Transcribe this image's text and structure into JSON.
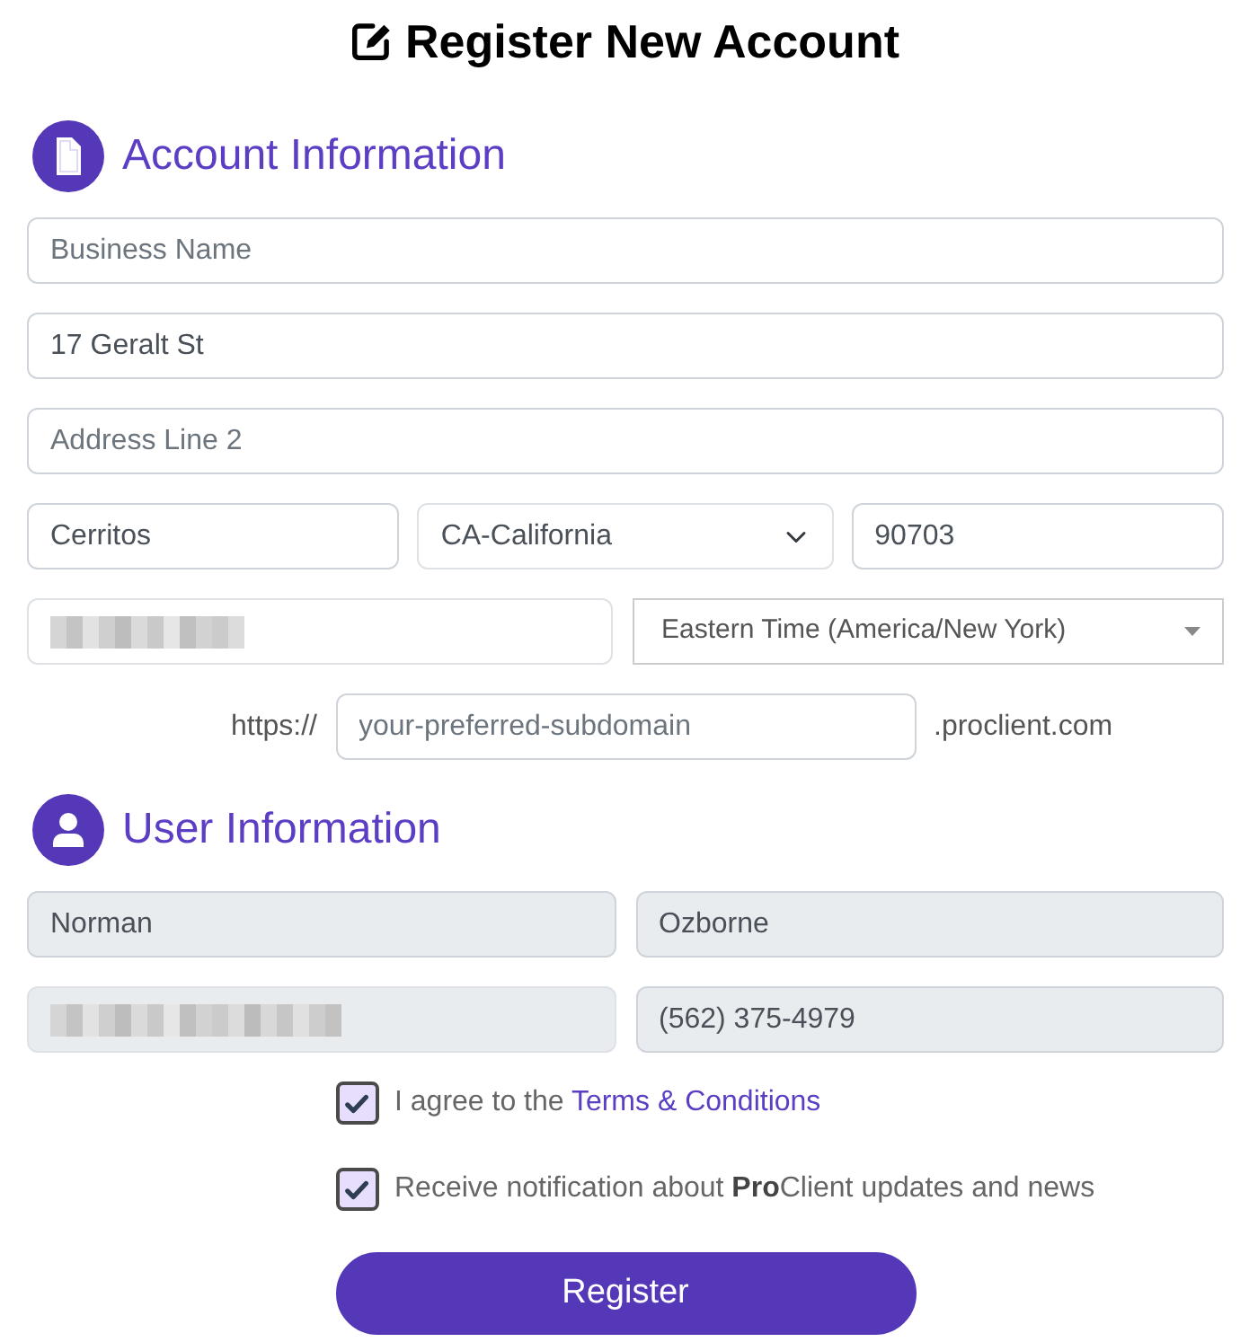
{
  "title": {
    "text": "Register New Account"
  },
  "sections": [
    {
      "kind": "document",
      "title": "Account Information",
      "lines": [
        {
          "fields": [
            {
              "kind": "text",
              "placeholder": "Business Name",
              "disabled": false,
              "redacted": false
            }
          ]
        },
        {
          "fields": [
            {
              "kind": "text",
              "value": "17 Geralt St",
              "disabled": false,
              "redacted": false
            }
          ]
        },
        {
          "fields": [
            {
              "kind": "text",
              "placeholder": "Address Line 2",
              "disabled": false,
              "redacted": false
            }
          ]
        },
        {
          "fields": [
            {
              "kind": "text",
              "value": "Cerritos",
              "disabled": false,
              "redacted": false
            },
            {
              "kind": "select",
              "value": "CA-California",
              "disabled": false,
              "redacted": false
            },
            {
              "kind": "text",
              "value": "90703",
              "disabled": false,
              "redacted": false
            }
          ]
        },
        {
          "fields": [
            {
              "kind": "text",
              "disabled": false,
              "redacted": true
            },
            {
              "kind": "dropdown",
              "value": "Eastern Time (America/New York)",
              "disabled": false,
              "redacted": false
            }
          ]
        }
      ],
      "subdomain": {
        "prefix": "https://",
        "placeholder": "your-preferred-subdomain",
        "suffix": ".proclient.com"
      }
    },
    {
      "kind": "user",
      "title": "User Information",
      "lines": [
        {
          "fields": [
            {
              "kind": "text",
              "value": "Norman",
              "disabled": true,
              "redacted": false
            },
            {
              "kind": "text",
              "value": "Ozborne",
              "disabled": true,
              "redacted": false
            }
          ]
        },
        {
          "fields": [
            {
              "kind": "text",
              "disabled": true,
              "redacted": true
            },
            {
              "kind": "text",
              "value": "(562) 375-4979",
              "disabled": true,
              "redacted": false
            }
          ]
        }
      ]
    }
  ],
  "checkboxes": [
    {
      "text": "I agree to the",
      "link": "Terms & Conditions",
      "checked": true
    },
    {
      "text": "Receive notification about **Pro**Client updates and news",
      "checked": true
    }
  ],
  "button": {
    "label": "Register"
  }
}
